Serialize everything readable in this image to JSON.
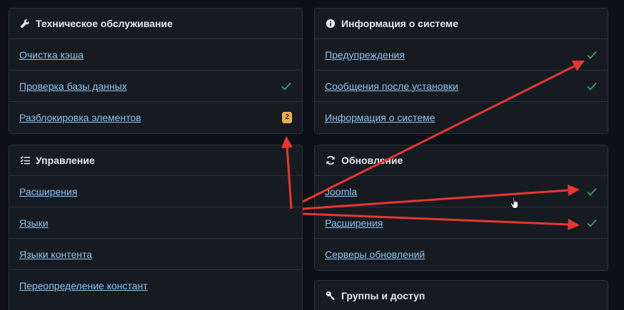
{
  "colors": {
    "bg": "#0d1117",
    "card": "#161b22",
    "link": "#8fc2ec",
    "check": "#3fa35b",
    "badge": "#f0ad4e",
    "arrow": "#e8362f"
  },
  "maintenance": {
    "title": "Техническое обслуживание",
    "icon": "wrench-icon",
    "items": [
      {
        "label": "Очистка кэша"
      },
      {
        "label": "Проверка базы данных"
      },
      {
        "label": "Разблокировка элементов",
        "badge": "2"
      }
    ]
  },
  "sysinfo": {
    "title": "Информация о системе",
    "icon": "info-circle-icon",
    "items": [
      {
        "label": "Предупреждения"
      },
      {
        "label": "Сообщения после установки"
      },
      {
        "label": "Информация о системе"
      }
    ]
  },
  "manage": {
    "title": "Управление",
    "icon": "list-check-icon",
    "items": [
      {
        "label": "Расширения"
      },
      {
        "label": "Языки"
      },
      {
        "label": "Языки контента"
      },
      {
        "label": "Переопределение констант"
      }
    ]
  },
  "update": {
    "title": "Обновление",
    "icon": "sync-icon",
    "items": [
      {
        "label": "Joomla"
      },
      {
        "label": "Расширения"
      },
      {
        "label": "Серверы обновлений"
      }
    ]
  },
  "groups": {
    "title": "Группы и доступ",
    "icon": "key-icon"
  }
}
